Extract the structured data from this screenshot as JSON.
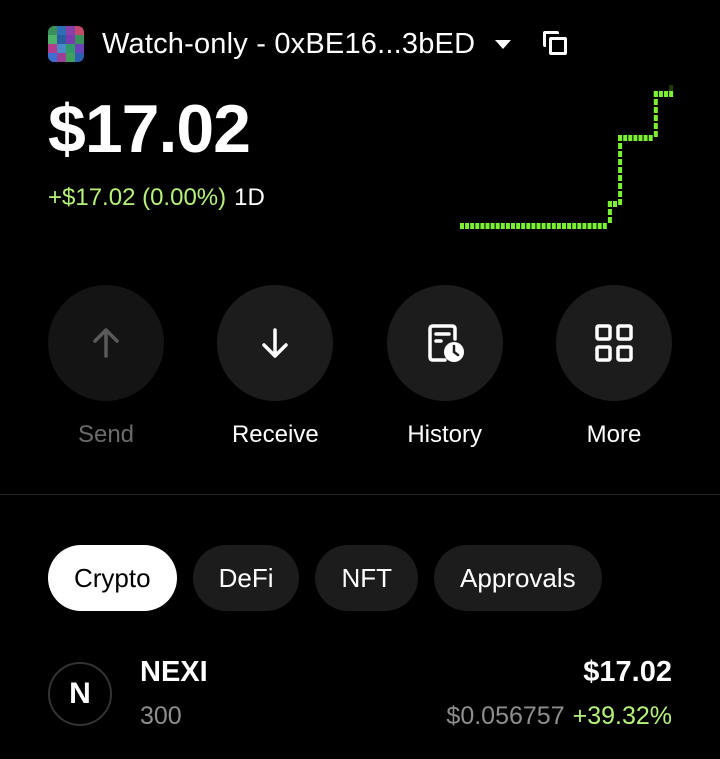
{
  "wallet": {
    "name": "Watch-only - 0xBE16...3bED",
    "avatar_colors": [
      "#3a8f5a",
      "#2f6db5",
      "#8b3fa8",
      "#c44a6b",
      "#4fb36c",
      "#285ea0",
      "#7a3bb0",
      "#3a8f5a",
      "#b33d8e",
      "#4a8ac9",
      "#2f9b6a",
      "#6d42b9",
      "#3b6fd0",
      "#9c3f96",
      "#3fa05e",
      "#2c5fb0"
    ]
  },
  "balance": {
    "amount": "$17.02",
    "change": "+$17.02 (0.00%)",
    "period": "1D"
  },
  "sparkline": {
    "color": "#7cf032",
    "values": [
      0,
      0,
      0,
      0,
      0,
      0,
      0,
      0,
      0,
      0,
      0,
      0,
      0,
      0,
      0,
      0,
      0,
      0,
      0,
      0,
      0,
      0,
      0,
      0,
      0,
      0,
      0,
      0,
      0,
      1,
      1,
      4,
      4,
      4,
      4,
      4,
      4,
      4,
      6,
      6,
      6,
      6
    ]
  },
  "actions": [
    {
      "label": "Send",
      "icon": "arrow-up-icon",
      "enabled": false
    },
    {
      "label": "Receive",
      "icon": "arrow-down-icon",
      "enabled": true
    },
    {
      "label": "History",
      "icon": "history-icon",
      "enabled": true
    },
    {
      "label": "More",
      "icon": "grid-icon",
      "enabled": true
    }
  ],
  "tabs": [
    {
      "label": "Crypto",
      "active": true
    },
    {
      "label": "DeFi",
      "active": false
    },
    {
      "label": "NFT",
      "active": false
    },
    {
      "label": "Approvals",
      "active": false
    }
  ],
  "tokens": [
    {
      "logo_letter": "N",
      "symbol": "NEXI",
      "amount": "300",
      "value": "$17.02",
      "price": "$0.056757",
      "change": "+39.32%"
    }
  ]
}
